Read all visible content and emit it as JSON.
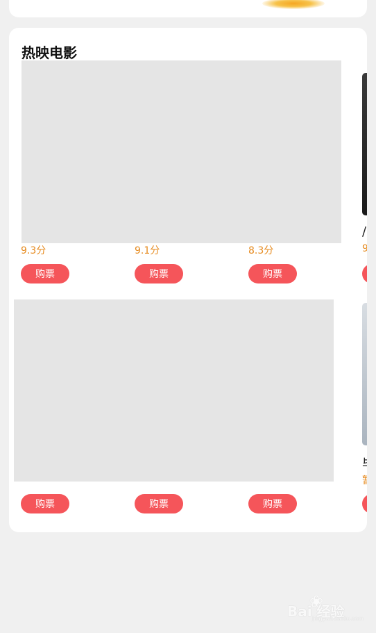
{
  "section": {
    "title": "热映电影"
  },
  "row1": {
    "scores": [
      "9.3分",
      "9.1分",
      "8.3分",
      "9"
    ],
    "buy_label": "购票",
    "title_fragment": "/"
  },
  "row2": {
    "buy_label": "购票",
    "title_fragment": "毕",
    "score_fragment": "暂"
  },
  "watermark": {
    "brand": "Bai 经验",
    "url": "jingyan.baidu.com"
  },
  "colors": {
    "background": "#f0f0f0",
    "card": "#ffffff",
    "score": "#e68a1e",
    "buy_button": "#f5555a",
    "placeholder": "#e5e5e5"
  },
  "icons": [
    "baidu-paw-icon"
  ]
}
